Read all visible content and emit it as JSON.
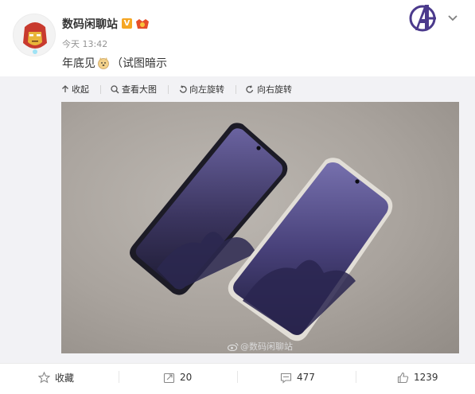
{
  "user": {
    "name": "数码闲聊站",
    "time": "今天 13:42"
  },
  "post": {
    "text_before": "年底见",
    "text_after": "（试图暗示"
  },
  "toolbar": {
    "collapse": "收起",
    "view_large": "查看大图",
    "rotate_left": "向左旋转",
    "rotate_right": "向右旋转"
  },
  "watermark": "@数码闲聊站",
  "actions": {
    "favorite": "收藏",
    "repost": "20",
    "comment": "477",
    "like": "1239"
  },
  "colors": {
    "badge": "#f5a623",
    "vip": "#e64e2a",
    "logo": "#4b3a8c"
  }
}
